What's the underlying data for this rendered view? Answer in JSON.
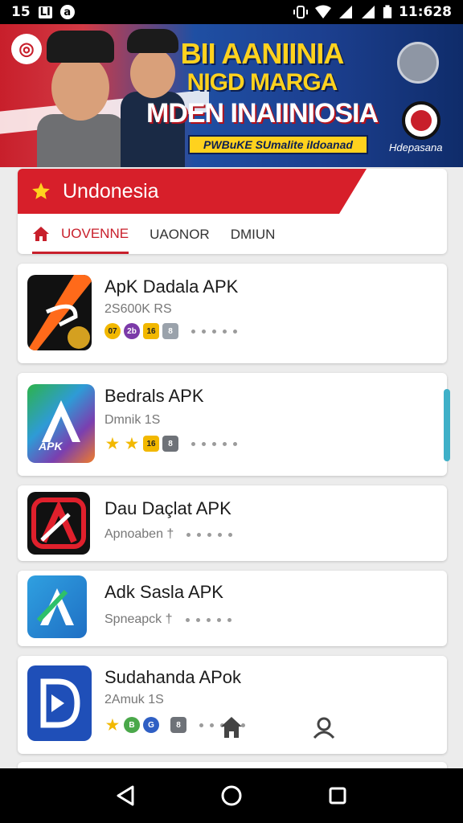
{
  "status_bar": {
    "left_icons": [
      "15",
      "LI",
      "a"
    ],
    "time": "11:628",
    "icons": [
      "vibrate-icon",
      "wifi-icon",
      "signal-icon",
      "signal-icon",
      "battery-icon"
    ]
  },
  "banner": {
    "line1": "BII AANIINIA",
    "line2": "NIGD MARGA",
    "line3": "MDEN INAIINIOSIA",
    "tagline": "PWBuKE SUmalite iIdoanad",
    "brand": "Hdepasana"
  },
  "header": {
    "title": "Undonesia",
    "tabs": [
      {
        "label": "UOVENNE"
      },
      {
        "label": "UAONOR"
      },
      {
        "label": "DMIUN"
      }
    ]
  },
  "apps": [
    {
      "name": "ApK Dadala APK",
      "sub": "2S600K RS",
      "badges": [
        "07",
        "2b",
        "16",
        "8"
      ]
    },
    {
      "name": "Bedrals APK",
      "sub": "Dmnik 1S",
      "badges": [
        "★",
        "★",
        "16",
        "8"
      ]
    },
    {
      "name": "Dau Daçlat APK",
      "sub": "Apnoaben †",
      "badges": []
    },
    {
      "name": "Adk Sasla APK",
      "sub": "Spneapck †",
      "badges": []
    },
    {
      "name": "Sudahanda APok",
      "sub": "2Amuk 1S",
      "badges": [
        "★",
        "B",
        "G",
        "8"
      ]
    }
  ],
  "colors": {
    "accent_red": "#d71f2a",
    "banner_blue": "#1c3f8f",
    "banner_yellow": "#ffd21e"
  }
}
